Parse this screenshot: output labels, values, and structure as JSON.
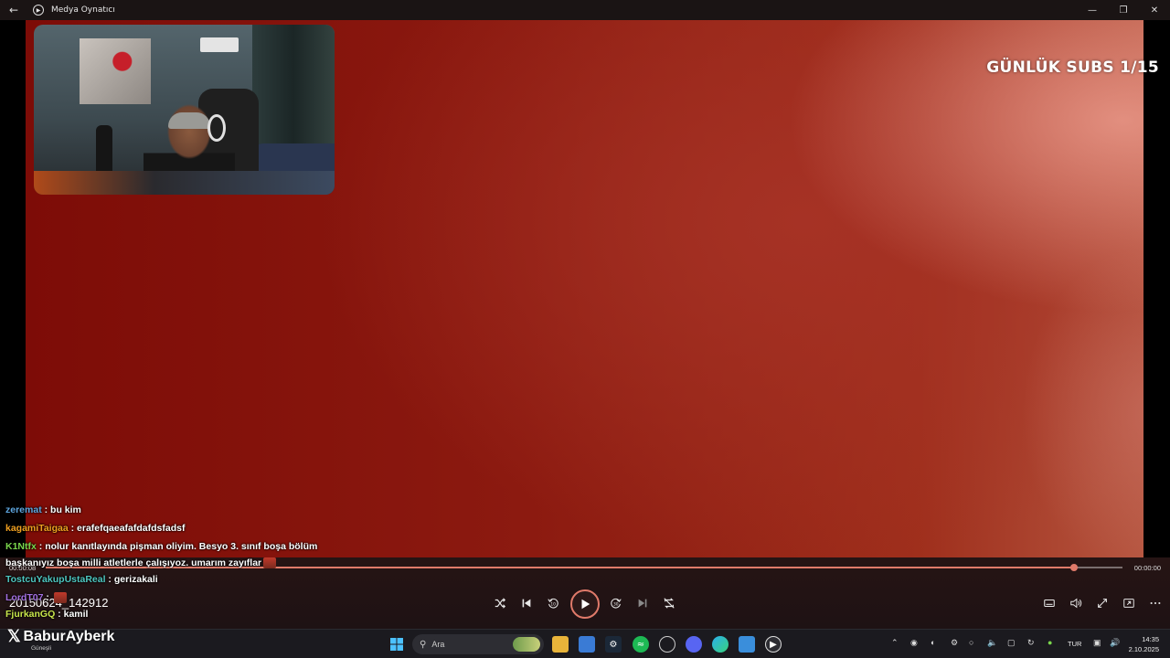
{
  "window": {
    "title": "Medya Oynatıcı",
    "back_icon": "back-arrow-icon",
    "minimize_glyph": "—",
    "maximize_glyph": "❐",
    "close_glyph": "✕"
  },
  "video": {
    "overlay_text": "GÜNLÜK SUBS 1/15"
  },
  "chat": [
    {
      "user": "zeremat",
      "sep": " : ",
      "message": "bu kim",
      "color": "#5ea6e0"
    },
    {
      "user": "kagamiTaigaa",
      "sep": " : ",
      "message": "erafefqaeafafdafdsfadsf",
      "color": "#f0a020"
    },
    {
      "user": "K1Ntfx",
      "sep": " : ",
      "message": "nolur kanıtlayında pişman oliyim. Besyo 3. sınıf boşa bölüm",
      "color": "#7ad64c"
    },
    {
      "user": "",
      "sep": "",
      "message": "başkanıyız boşa milli atletlerle çalışıyoz. umarım zayıflar",
      "color": "#ffffff"
    },
    {
      "user": "TostcuYakupUstaReal",
      "sep": " : ",
      "message": "gerizakali",
      "color": "#4ec7c0"
    },
    {
      "user": "LordT07",
      "sep": " : ",
      "message": "",
      "color": "#a36fe0"
    },
    {
      "user": "FjurkanGQ",
      "sep": " : ",
      "message": "kamil",
      "color": "#c9e64c"
    }
  ],
  "player": {
    "current_time": "00:00:08",
    "total_time": "00:00:00",
    "progress": 0.955,
    "filename": "20150624_142912",
    "accent_color": "#e07a6a"
  },
  "watermark": {
    "name": "BaburAyberk",
    "subtitle": "Güneşli"
  },
  "taskbar": {
    "search_placeholder": "Ara",
    "language": "TUR",
    "time": "14:35",
    "date": "2.10.2025"
  }
}
